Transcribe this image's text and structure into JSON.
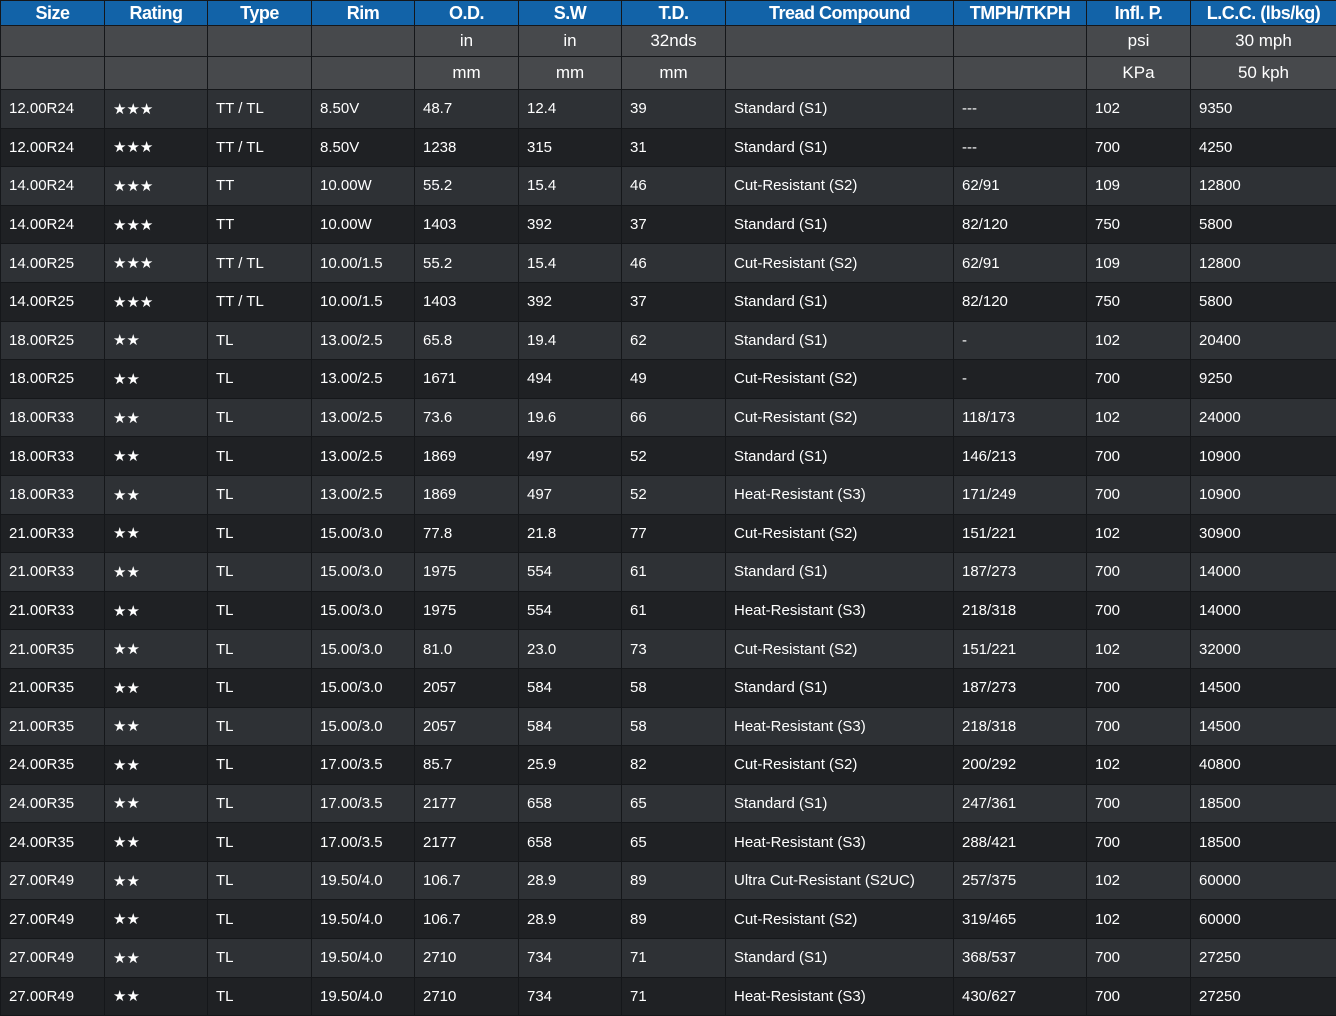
{
  "columns": [
    "Size",
    "Rating",
    "Type",
    "Rim",
    "O.D.",
    "S.W",
    "T.D.",
    "Tread Compound",
    "TMPH/TKPH",
    "Infl. P.",
    "L.C.C. (lbs/kg)"
  ],
  "units_imperial": [
    "",
    "",
    "",
    "",
    "in",
    "in",
    "32nds",
    "",
    "",
    "psi",
    "30 mph"
  ],
  "units_metric": [
    "",
    "",
    "",
    "",
    "mm",
    "mm",
    "mm",
    "",
    "",
    "KPa",
    "50 kph"
  ],
  "rows": [
    [
      "12.00R24",
      "★★★",
      "TT / TL",
      "8.50V",
      "48.7",
      "12.4",
      "39",
      "Standard (S1)",
      "---",
      "102",
      "9350"
    ],
    [
      "12.00R24",
      "★★★",
      "TT / TL",
      "8.50V",
      "1238",
      "315",
      "31",
      "Standard (S1)",
      "---",
      "700",
      "4250"
    ],
    [
      "14.00R24",
      "★★★",
      "TT",
      "10.00W",
      "55.2",
      "15.4",
      "46",
      "Cut-Resistant (S2)",
      "62/91",
      "109",
      "12800"
    ],
    [
      "14.00R24",
      "★★★",
      "TT",
      "10.00W",
      "1403",
      "392",
      "37",
      "Standard (S1)",
      "82/120",
      "750",
      "5800"
    ],
    [
      "14.00R25",
      "★★★",
      "TT / TL",
      "10.00/1.5",
      "55.2",
      "15.4",
      "46",
      "Cut-Resistant (S2)",
      "62/91",
      "109",
      "12800"
    ],
    [
      "14.00R25",
      "★★★",
      "TT / TL",
      "10.00/1.5",
      "1403",
      "392",
      "37",
      "Standard (S1)",
      "82/120",
      "750",
      "5800"
    ],
    [
      "18.00R25",
      "★★",
      "TL",
      "13.00/2.5",
      "65.8",
      "19.4",
      "62",
      "Standard (S1)",
      "-",
      "102",
      "20400"
    ],
    [
      "18.00R25",
      "★★",
      "TL",
      "13.00/2.5",
      "1671",
      "494",
      "49",
      "Cut-Resistant (S2)",
      "-",
      "700",
      "9250"
    ],
    [
      "18.00R33",
      "★★",
      "TL",
      "13.00/2.5",
      "73.6",
      "19.6",
      "66",
      "Cut-Resistant (S2)",
      "118/173",
      "102",
      "24000"
    ],
    [
      "18.00R33",
      "★★",
      "TL",
      "13.00/2.5",
      "1869",
      "497",
      "52",
      "Standard (S1)",
      "146/213",
      "700",
      "10900"
    ],
    [
      "18.00R33",
      "★★",
      "TL",
      "13.00/2.5",
      "1869",
      "497",
      "52",
      "Heat-Resistant (S3)",
      "171/249",
      "700",
      "10900"
    ],
    [
      "21.00R33",
      "★★",
      "TL",
      "15.00/3.0",
      "77.8",
      "21.8",
      "77",
      "Cut-Resistant (S2)",
      "151/221",
      "102",
      "30900"
    ],
    [
      "21.00R33",
      "★★",
      "TL",
      "15.00/3.0",
      "1975",
      "554",
      "61",
      "Standard (S1)",
      "187/273",
      "700",
      "14000"
    ],
    [
      "21.00R33",
      "★★",
      "TL",
      "15.00/3.0",
      "1975",
      "554",
      "61",
      "Heat-Resistant (S3)",
      "218/318",
      "700",
      "14000"
    ],
    [
      "21.00R35",
      "★★",
      "TL",
      "15.00/3.0",
      "81.0",
      "23.0",
      "73",
      "Cut-Resistant (S2)",
      "151/221",
      "102",
      "32000"
    ],
    [
      "21.00R35",
      "★★",
      "TL",
      "15.00/3.0",
      "2057",
      "584",
      "58",
      "Standard (S1)",
      "187/273",
      "700",
      "14500"
    ],
    [
      "21.00R35",
      "★★",
      "TL",
      "15.00/3.0",
      "2057",
      "584",
      "58",
      "Heat-Resistant (S3)",
      "218/318",
      "700",
      "14500"
    ],
    [
      "24.00R35",
      "★★",
      "TL",
      "17.00/3.5",
      "85.7",
      "25.9",
      "82",
      "Cut-Resistant (S2)",
      "200/292",
      "102",
      "40800"
    ],
    [
      "24.00R35",
      "★★",
      "TL",
      "17.00/3.5",
      "2177",
      "658",
      "65",
      "Standard (S1)",
      "247/361",
      "700",
      "18500"
    ],
    [
      "24.00R35",
      "★★",
      "TL",
      "17.00/3.5",
      "2177",
      "658",
      "65",
      "Heat-Resistant (S3)",
      "288/421",
      "700",
      "18500"
    ],
    [
      "27.00R49",
      "★★",
      "TL",
      "19.50/4.0",
      "106.7",
      "28.9",
      "89",
      "Ultra Cut-Resistant (S2UC)",
      "257/375",
      "102",
      "60000"
    ],
    [
      "27.00R49",
      "★★",
      "TL",
      "19.50/4.0",
      "106.7",
      "28.9",
      "89",
      "Cut-Resistant (S2)",
      "319/465",
      "102",
      "60000"
    ],
    [
      "27.00R49",
      "★★",
      "TL",
      "19.50/4.0",
      "2710",
      "734",
      "71",
      "Standard (S1)",
      "368/537",
      "700",
      "27250"
    ],
    [
      "27.00R49",
      "★★",
      "TL",
      "19.50/4.0",
      "2710",
      "734",
      "71",
      "Heat-Resistant (S3)",
      "430/627",
      "700",
      "27250"
    ]
  ]
}
